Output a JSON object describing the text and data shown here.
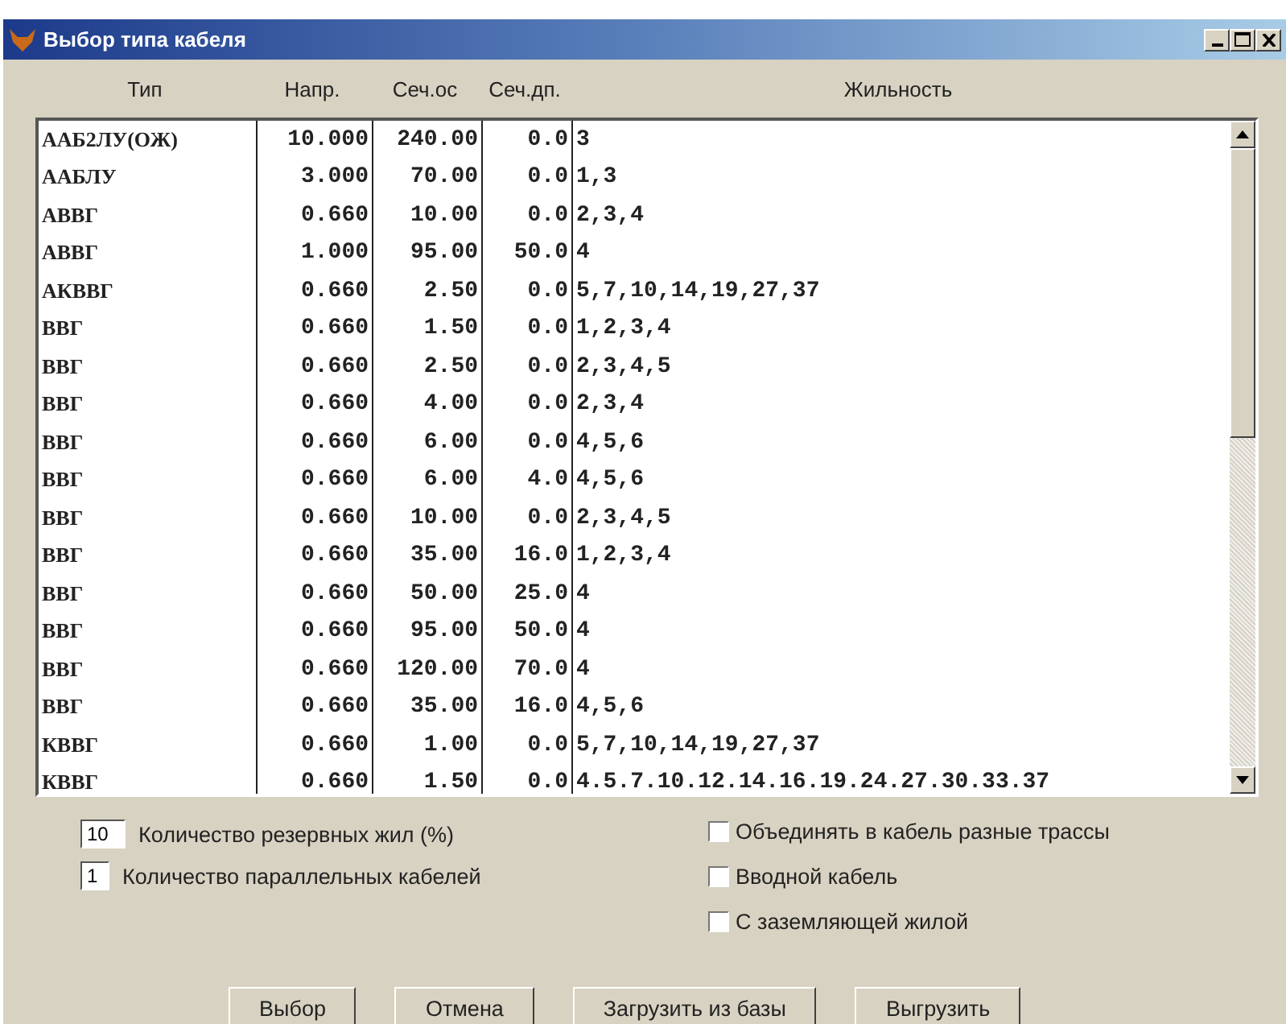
{
  "window": {
    "title": "Выбор типа кабеля"
  },
  "table": {
    "columns": [
      "Тип",
      "Напр.",
      "Сеч.ос",
      "Сеч.дп.",
      "Жильность"
    ],
    "rows": [
      [
        "ААБ2ЛУ(ОЖ)",
        "10.000",
        "240.00",
        "0.0",
        "3"
      ],
      [
        "ААБЛУ",
        "3.000",
        "70.00",
        "0.0",
        "1,3"
      ],
      [
        "АВВГ",
        "0.660",
        "10.00",
        "0.0",
        "2,3,4"
      ],
      [
        "АВВГ",
        "1.000",
        "95.00",
        "50.0",
        "4"
      ],
      [
        "АКВВГ",
        "0.660",
        "2.50",
        "0.0",
        "5,7,10,14,19,27,37"
      ],
      [
        "ВВГ",
        "0.660",
        "1.50",
        "0.0",
        "1,2,3,4"
      ],
      [
        "ВВГ",
        "0.660",
        "2.50",
        "0.0",
        "2,3,4,5"
      ],
      [
        "ВВГ",
        "0.660",
        "4.00",
        "0.0",
        "2,3,4"
      ],
      [
        "ВВГ",
        "0.660",
        "6.00",
        "0.0",
        "4,5,6"
      ],
      [
        "ВВГ",
        "0.660",
        "6.00",
        "4.0",
        "4,5,6"
      ],
      [
        "ВВГ",
        "0.660",
        "10.00",
        "0.0",
        "2,3,4,5"
      ],
      [
        "ВВГ",
        "0.660",
        "35.00",
        "16.0",
        "1,2,3,4"
      ],
      [
        "ВВГ",
        "0.660",
        "50.00",
        "25.0",
        "4"
      ],
      [
        "ВВГ",
        "0.660",
        "95.00",
        "50.0",
        "4"
      ],
      [
        "ВВГ",
        "0.660",
        "120.00",
        "70.0",
        "4"
      ],
      [
        "ВВГ",
        "0.660",
        "35.00",
        "16.0",
        "4,5,6"
      ],
      [
        "КВВГ",
        "0.660",
        "1.00",
        "0.0",
        "5,7,10,14,19,27,37"
      ],
      [
        "КВВГ",
        "0.660",
        "1.50",
        "0.0",
        "4.5.7.10.12.14.16.19.24.27.30.33.37"
      ]
    ]
  },
  "fields": [
    {
      "value": "10",
      "label": "Количество резервных жил (%)"
    },
    {
      "value": "1",
      "label": "Количество параллельных кабелей"
    }
  ],
  "checkboxes": [
    {
      "label": "Объединять в кабель разные трассы",
      "checked": false
    },
    {
      "label": "Вводной кабель",
      "checked": false
    },
    {
      "label": "С заземляющей жилой",
      "checked": false
    }
  ],
  "buttons": [
    "Выбор",
    "Отмена",
    "Загрузить из базы",
    "Выгрузить"
  ]
}
